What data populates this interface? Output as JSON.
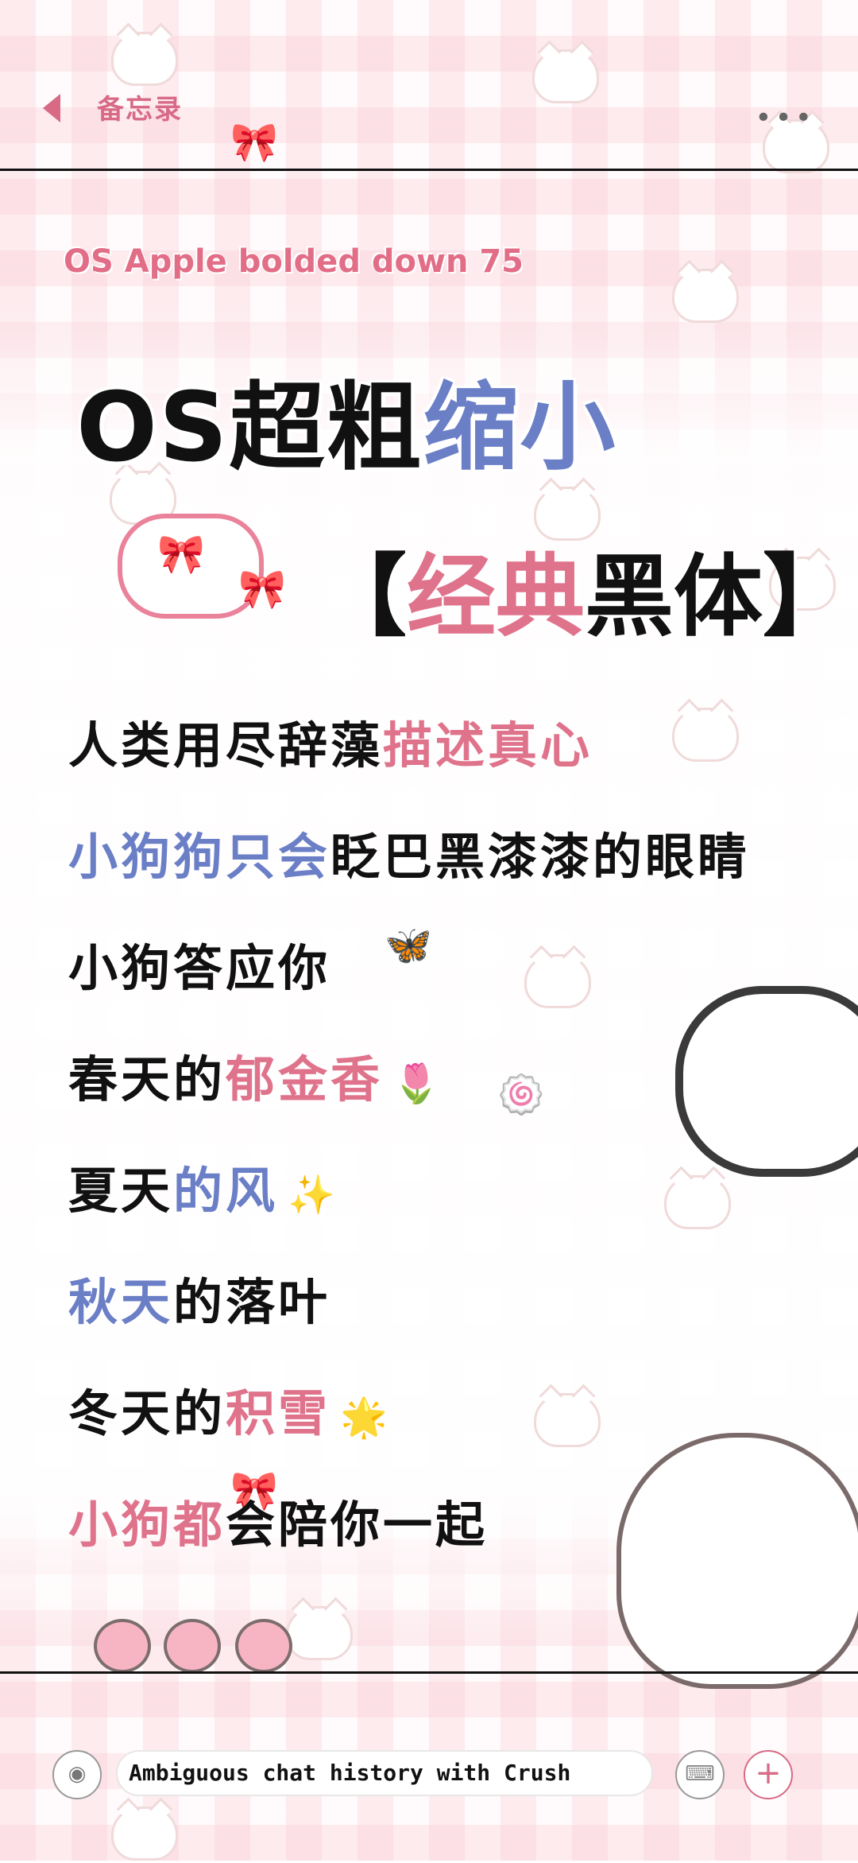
{
  "header": {
    "title": "备忘录",
    "more": "•••"
  },
  "subtitle": "OS Apple bolded down 75",
  "headline": {
    "black": "OS超粗",
    "blue": "缩小"
  },
  "subheadline": {
    "open": "【",
    "pink": "经典",
    "black": "黑体",
    "close": "】"
  },
  "lines": [
    {
      "a": "人类用尽辞藻",
      "b": "描述真心",
      "b_color": "pink",
      "emoji": ""
    },
    {
      "a": "小狗狗只会",
      "b": "眨巴黑漆漆的眼睛",
      "a_color": "blue",
      "emoji": ""
    },
    {
      "a": "小狗答应你",
      "b": "",
      "emoji": ""
    },
    {
      "a": "春天的",
      "b": "郁金香",
      "b_color": "pink",
      "emoji": "🌷"
    },
    {
      "a": "夏天",
      "b": "的风",
      "b_color": "blue",
      "emoji": "✨"
    },
    {
      "a": "秋天",
      "b": "的落叶",
      "a_color": "blue",
      "emoji": ""
    },
    {
      "a": "冬天的",
      "b": "积雪",
      "b_color": "pink",
      "emoji": "🌟"
    },
    {
      "a": "小狗都",
      "b": "会陪你一起",
      "a_color": "pink",
      "emoji": ""
    }
  ],
  "input": {
    "text": "Ambiguous chat history with Crush"
  },
  "icons": {
    "voice": "voice-icon",
    "keyboard": "keyboard-icon",
    "plus": "plus-icon"
  },
  "colors": {
    "pink": "#e0738c",
    "blue": "#6b7fc7"
  }
}
